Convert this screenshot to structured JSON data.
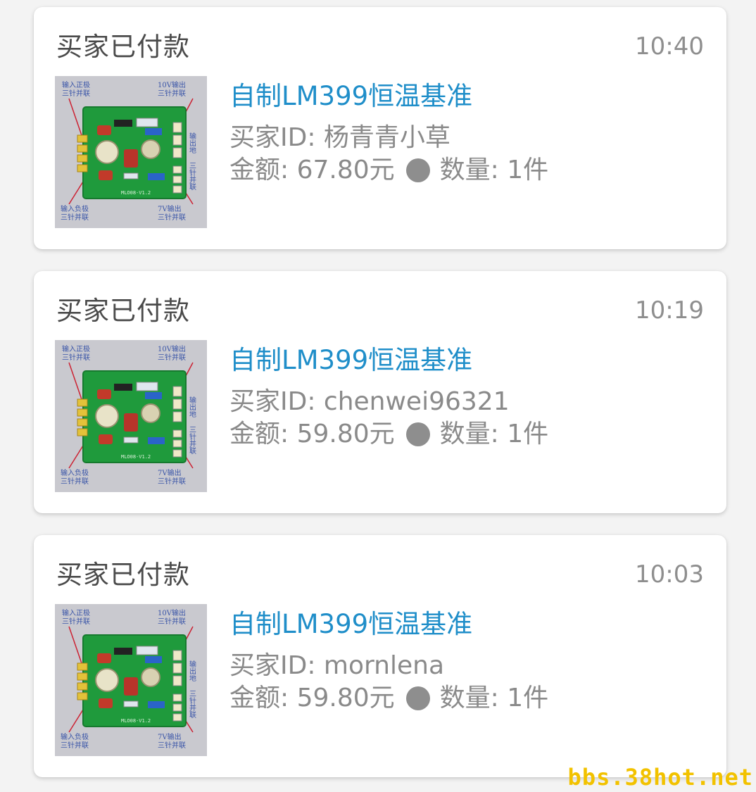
{
  "orders": [
    {
      "status": "买家已付款",
      "time": "10:40",
      "product": "自制LM399恒温基准",
      "buyer_id": "买家ID: 杨青青小草",
      "amount": "金额: 67.80元",
      "quantity": "数量: 1件",
      "thumbnail": {
        "labels": [
          "输入正极",
          "三针并联",
          "10V输出",
          "三针并联",
          "输出地",
          "三针并联",
          "输入负极",
          "三针并联",
          "7V输出",
          "三针并联"
        ],
        "board_label": "MLO08-V1.2"
      }
    },
    {
      "status": "买家已付款",
      "time": "10:19",
      "product": "自制LM399恒温基准",
      "buyer_id": "买家ID: chenwei96321",
      "amount": "金额: 59.80元",
      "quantity": "数量: 1件",
      "thumbnail": {
        "labels": [
          "输入正极",
          "三针并联",
          "10V输出",
          "三针并联",
          "输出地",
          "三针并联",
          "输入负极",
          "三针并联",
          "7V输出",
          "三针并联"
        ],
        "board_label": "MLO08-V1.2"
      }
    },
    {
      "status": "买家已付款",
      "time": "10:03",
      "product": "自制LM399恒温基准",
      "buyer_id": "买家ID: mornlena",
      "amount": "金额: 59.80元",
      "quantity": "数量: 1件",
      "thumbnail": {
        "labels": [
          "输入正极",
          "三针并联",
          "10V输出",
          "三针并联",
          "输出地",
          "三针并联",
          "输入负极",
          "三针并联",
          "7V输出",
          "三针并联"
        ],
        "board_label": "MLO08-V1.2"
      }
    }
  ],
  "colors": {
    "title_blue": "#1f8ec9",
    "text_gray": "#8a8a8a",
    "status_dark": "#4a4a4a",
    "pcb_green": "#1f9a3c",
    "watermark_yellow": "#f2c200"
  },
  "watermark": "bbs.38hot.net"
}
